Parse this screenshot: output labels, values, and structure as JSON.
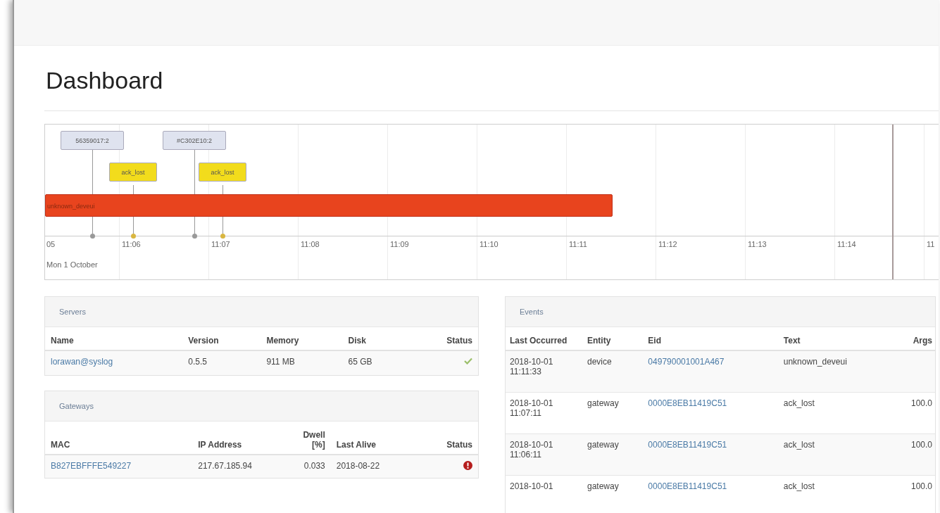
{
  "page_title": "Dashboard",
  "timeline": {
    "axis_labels": [
      "05",
      "11:06",
      "11:07",
      "11:08",
      "11:09",
      "11:10",
      "11:11",
      "11:12",
      "11:13",
      "11:14",
      "11"
    ],
    "date_label": "Mon 1 October",
    "items": [
      {
        "kind": "box",
        "label": "56359017:2",
        "color": "#dfe3ef"
      },
      {
        "kind": "box",
        "label": "ack_lost",
        "color": "#f2dc1c"
      },
      {
        "kind": "box",
        "label": "#C302E10:2",
        "color": "#dfe3ef"
      },
      {
        "kind": "box",
        "label": "ack_lost",
        "color": "#f2dc1c"
      },
      {
        "kind": "range",
        "label": "unknown_deveui",
        "color": "#e8441e"
      }
    ]
  },
  "servers": {
    "title": "Servers",
    "columns": [
      "Name",
      "Version",
      "Memory",
      "Disk",
      "Status"
    ],
    "rows": [
      {
        "name": "lorawan@syslog",
        "version": "0.5.5",
        "memory": "911 MB",
        "disk": "65 GB",
        "status_ok": true
      }
    ]
  },
  "gateways": {
    "title": "Gateways",
    "columns": [
      "MAC",
      "IP Address",
      "Dwell [%]",
      "Last Alive",
      "Status"
    ],
    "rows": [
      {
        "mac": "B827EBFFFE549227",
        "ip": "217.67.185.94",
        "dwell": "0.033",
        "last_alive": "2018-08-22",
        "status_ok": false
      }
    ]
  },
  "events": {
    "title": "Events",
    "columns": [
      "Last Occurred",
      "Entity",
      "Eid",
      "Text",
      "Args"
    ],
    "rows": [
      {
        "occurred": "2018-10-01 11:11:33",
        "entity": "device",
        "eid": "049790001001A467",
        "text": "unknown_deveui"
      },
      {
        "occurred": "2018-10-01 11:07:11",
        "entity": "gateway",
        "eid": "0000E8EB11419C51",
        "text": "ack_lost",
        "args": "100.0"
      },
      {
        "occurred": "2018-10-01 11:06:11",
        "entity": "gateway",
        "eid": "0000E8EB11419C51",
        "text": "ack_lost",
        "args": "100.0"
      },
      {
        "occurred": "2018-10-01",
        "entity": "gateway",
        "eid": "0000E8EB11419C51",
        "text": "ack_lost",
        "args": "100.0"
      }
    ]
  }
}
